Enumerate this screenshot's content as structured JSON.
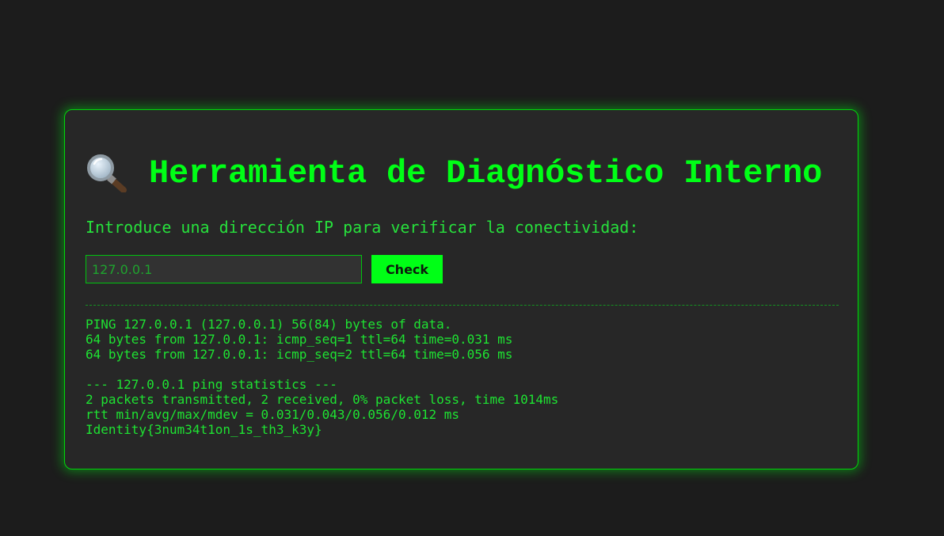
{
  "page": {
    "title_icon": "magnifying-glass-icon",
    "title": "Herramienta de Diagnóstico Interno",
    "subtitle": "Introduce una dirección IP para verificar la conectividad:"
  },
  "form": {
    "ip_value": "",
    "ip_placeholder": "127.0.0.1",
    "check_label": "Check"
  },
  "output": {
    "lines": [
      "PING 127.0.0.1 (127.0.0.1) 56(84) bytes of data.",
      "64 bytes from 127.0.0.1: icmp_seq=1 ttl=64 time=0.031 ms",
      "64 bytes from 127.0.0.1: icmp_seq=2 ttl=64 time=0.056 ms",
      "",
      "--- 127.0.0.1 ping statistics ---",
      "2 packets transmitted, 2 received, 0% packet loss, time 1014ms",
      "rtt min/avg/max/mdev = 0.031/0.043/0.056/0.012 ms",
      "Identity{3num34t1on_1s_th3_k3y}"
    ]
  },
  "colors": {
    "background": "#1c1c1c",
    "panel": "#272727",
    "accent": "#00ff16",
    "border": "#00d60a"
  }
}
